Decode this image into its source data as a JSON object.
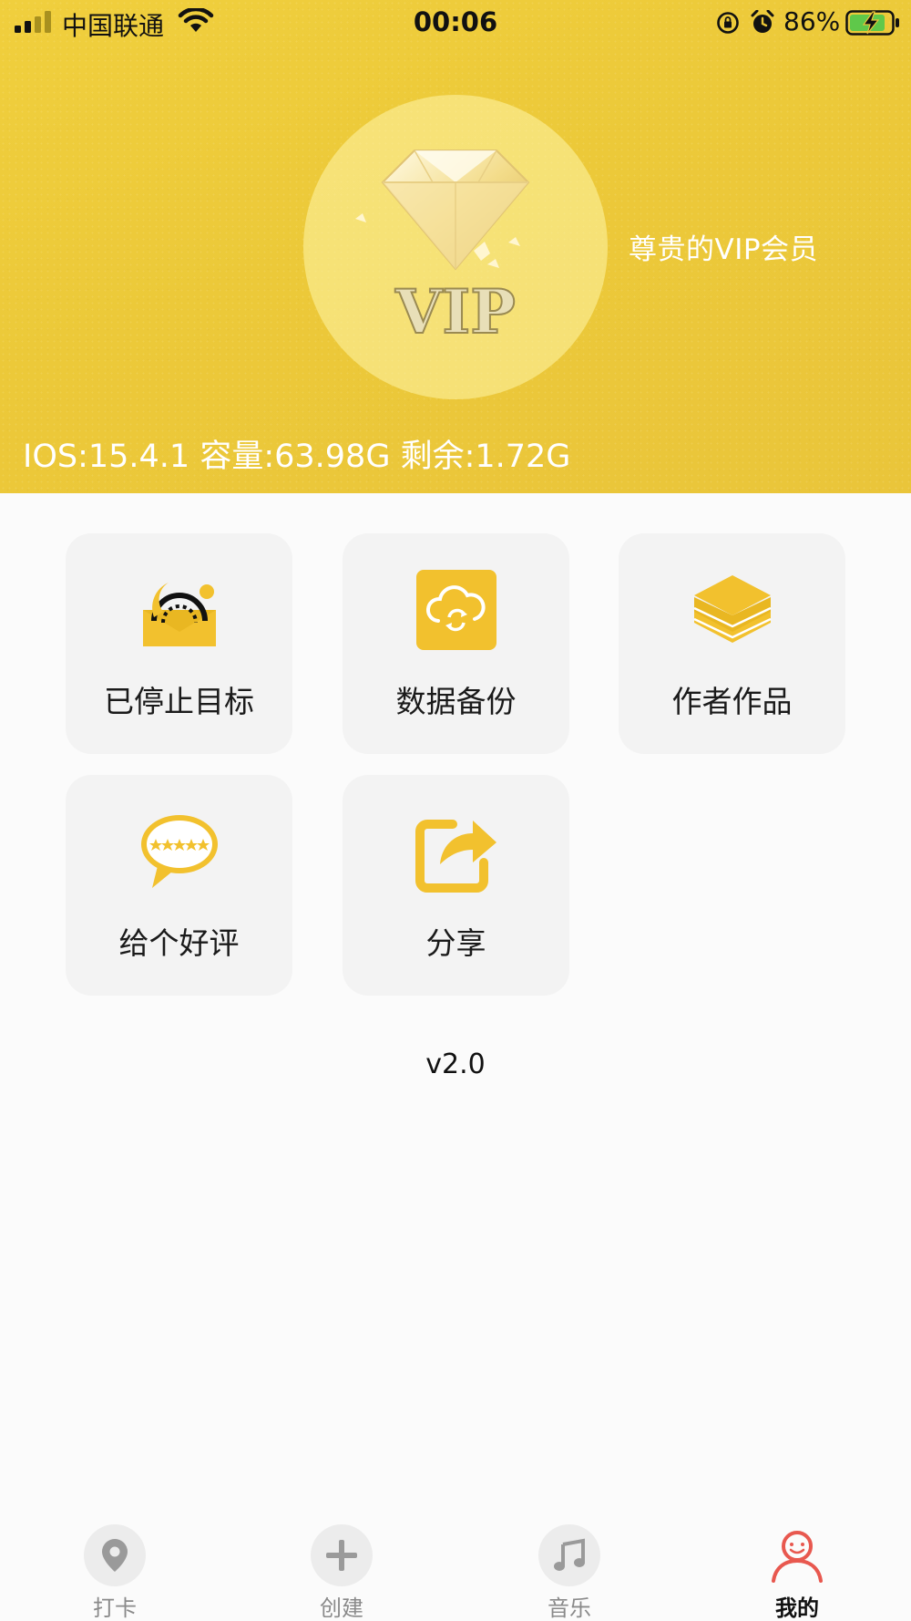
{
  "status_bar": {
    "carrier": "中国联通",
    "time": "00:06",
    "battery_percent": "86%"
  },
  "header": {
    "vip_badge_text": "VIP",
    "vip_label": "尊贵的VIP会员",
    "device_info": "IOS:15.4.1 容量:63.98G 剩余:1.72G"
  },
  "grid": {
    "items": [
      {
        "label": "已停止目标",
        "icon": "stopped-goals-icon"
      },
      {
        "label": "数据备份",
        "icon": "cloud-backup-icon"
      },
      {
        "label": "作者作品",
        "icon": "layers-icon"
      },
      {
        "label": "给个好评",
        "icon": "rating-bubble-icon"
      },
      {
        "label": "分享",
        "icon": "share-icon"
      }
    ]
  },
  "version": "v2.0",
  "tabbar": {
    "items": [
      {
        "label": "打卡",
        "icon": "location-pin-icon"
      },
      {
        "label": "创建",
        "icon": "plus-icon"
      },
      {
        "label": "音乐",
        "icon": "music-note-icon"
      },
      {
        "label": "我的",
        "icon": "person-icon",
        "active": true
      }
    ]
  },
  "colors": {
    "accent_yellow": "#F0C83C",
    "icon_yellow": "#F2C12E",
    "active_tab_red": "#E8584F",
    "tile_background": "#F3F3F3"
  }
}
